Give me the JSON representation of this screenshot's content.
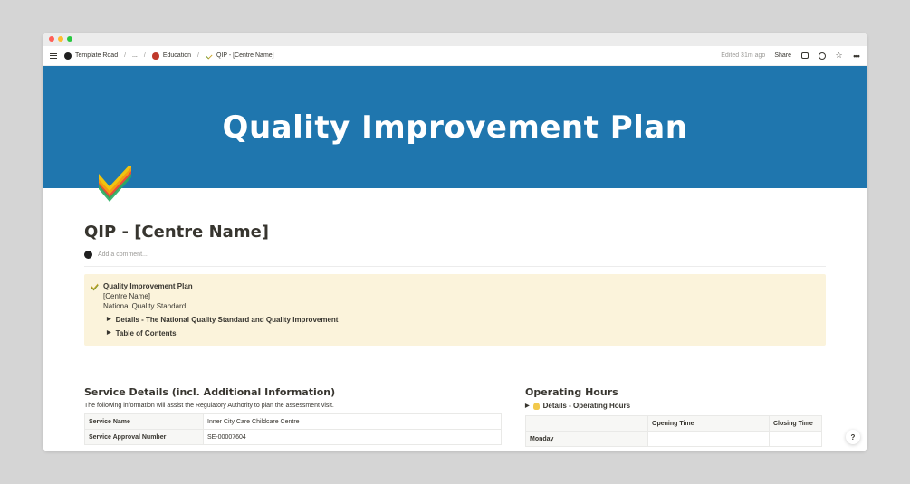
{
  "breadcrumb": {
    "items": [
      "Template Road",
      "...",
      "Education",
      "QIP - [Centre Name]"
    ]
  },
  "topbar": {
    "edited": "Edited 31m ago",
    "share": "Share"
  },
  "cover": {
    "title": "Quality Improvement Plan",
    "color": "#1f76ae"
  },
  "page": {
    "title": "QIP - [Centre Name]",
    "add_comment": "Add a comment..."
  },
  "callout": {
    "title": "Quality Improvement Plan",
    "line1": "[Centre Name]",
    "line2": "National Quality Standard",
    "toggle1": "Details - The National Quality Standard and Quality Improvement",
    "toggle2": "Table of Contents",
    "background": "#fbf3db"
  },
  "service": {
    "heading": "Service Details (incl. Additional Information)",
    "description": "The following information will assist the Regulatory Authority to plan the assessment visit.",
    "rows": [
      {
        "key": "Service Name",
        "value": "Inner City Care Childcare Centre"
      },
      {
        "key": "Service Approval Number",
        "value": "SE-00007604"
      }
    ]
  },
  "hours": {
    "heading": "Operating Hours",
    "toggle": "Details - Operating Hours",
    "columns": [
      "",
      "Opening Time",
      "Closing Time"
    ],
    "rows": [
      {
        "day": "Monday",
        "open": "",
        "close": ""
      }
    ]
  },
  "help": "?"
}
